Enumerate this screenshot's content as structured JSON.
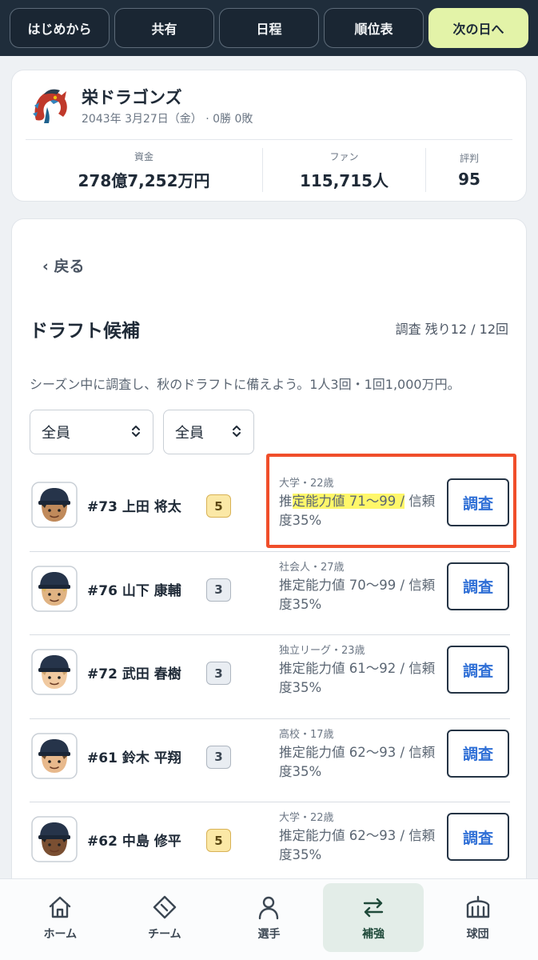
{
  "topbar": {
    "buttons": [
      "はじめから",
      "共有",
      "日程",
      "順位表",
      "次の日へ"
    ]
  },
  "team": {
    "name": "栄ドラゴンズ",
    "date_record": "2043年 3月27日（金） · 0勝 0敗",
    "stats": [
      {
        "label": "資金",
        "value": "278億7,252万円"
      },
      {
        "label": "ファン",
        "value": "115,715人"
      },
      {
        "label": "評判",
        "value": "95"
      }
    ]
  },
  "draft": {
    "back_label": "‹ 戻る",
    "title": "ドラフト候補",
    "remaining": "調査 残り12 / 12回",
    "description": "シーズン中に調査し、秋のドラフトに備えよう。1人3回・1回1,000万円。",
    "filters": [
      "全員",
      "全員"
    ],
    "survey_label": "調査",
    "candidates": [
      {
        "name": "#73 上田 将太",
        "rank": "5",
        "origin": "大学・22歳",
        "est_prefix": "推",
        "est_highlight": "定能力値 71〜99 /",
        "est_suffix": " 信頼度35%"
      },
      {
        "name": "#76 山下 康輔",
        "rank": "3",
        "origin": "社会人・27歳",
        "est_prefix": "",
        "est_highlight": "",
        "est_suffix": "推定能力値 70〜99 / 信頼度35%"
      },
      {
        "name": "#72 武田 春樹",
        "rank": "3",
        "origin": "独立リーグ・23歳",
        "est_prefix": "",
        "est_highlight": "",
        "est_suffix": "推定能力値 61〜92 / 信頼度35%"
      },
      {
        "name": "#61 鈴木 平翔",
        "rank": "3",
        "origin": "高校・17歳",
        "est_prefix": "",
        "est_highlight": "",
        "est_suffix": "推定能力値 62〜93 / 信頼度35%"
      },
      {
        "name": "#62 中島 修平",
        "rank": "5",
        "origin": "大学・22歳",
        "est_prefix": "",
        "est_highlight": "",
        "est_suffix": "推定能力値 62〜93 / 信頼度35%"
      }
    ]
  },
  "nav": {
    "items": [
      "ホーム",
      "チーム",
      "選手",
      "補強",
      "球団"
    ],
    "active": "補強"
  },
  "colors": {
    "accent": "#e3f3a8",
    "topbar": "#1f2d3b",
    "survey_text": "#2f6fd6",
    "highlight": "#fff76a",
    "annotation": "#f04e2a"
  }
}
